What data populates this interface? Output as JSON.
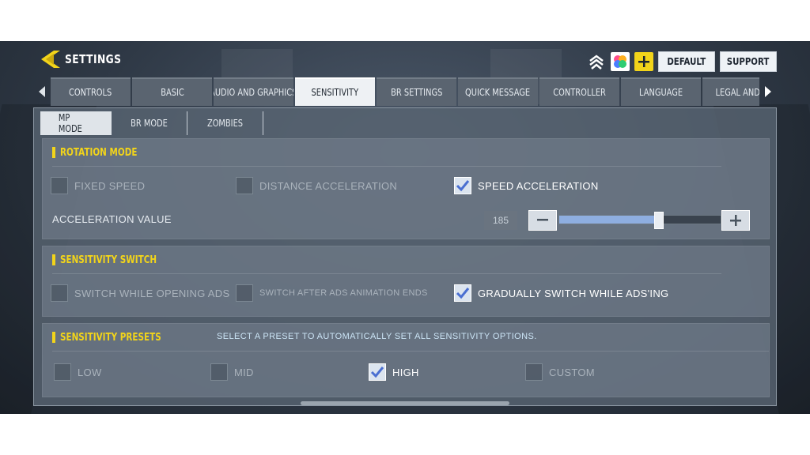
{
  "header": {
    "title": "SETTINGS",
    "icons": [
      "back-chevron-icon",
      "rank-icon",
      "color-blob-icon",
      "plus-icon"
    ],
    "buttons": {
      "default": "DEFAULT",
      "support": "SUPPORT"
    }
  },
  "tabs": [
    {
      "label": "CONTROLS",
      "active": false
    },
    {
      "label": "BASIC",
      "active": false
    },
    {
      "label": "AUDIO AND GRAPHICS",
      "active": false
    },
    {
      "label": "SENSITIVITY",
      "active": true
    },
    {
      "label": "BR SETTINGS",
      "active": false
    },
    {
      "label": "QUICK MESSAGE",
      "active": false
    },
    {
      "label": "CONTROLLER",
      "active": false
    },
    {
      "label": "LANGUAGE",
      "active": false
    },
    {
      "label": "LEGAL AND PI",
      "active": false
    }
  ],
  "subtabs": [
    {
      "label": "MP MODE",
      "active": true
    },
    {
      "label": "BR MODE",
      "active": false
    },
    {
      "label": "ZOMBIES",
      "active": false
    }
  ],
  "rotation_mode": {
    "title": "ROTATION MODE",
    "options": [
      {
        "label": "FIXED SPEED",
        "checked": false
      },
      {
        "label": "DISTANCE ACCELERATION",
        "checked": false
      },
      {
        "label": "SPEED ACCELERATION",
        "checked": true
      }
    ],
    "acceleration": {
      "label": "ACCELERATION VALUE",
      "value": "185",
      "fraction": 0.62
    }
  },
  "sensitivity_switch": {
    "title": "SENSITIVITY SWITCH",
    "options": [
      {
        "label": "SWITCH WHILE OPENING ADS",
        "checked": false
      },
      {
        "label": "SWITCH AFTER ADS ANIMATION ENDS",
        "checked": false
      },
      {
        "label": "GRADUALLY SWITCH WHILE ADS'ING",
        "checked": true
      }
    ]
  },
  "sensitivity_presets": {
    "title": "SENSITIVITY PRESETS",
    "description": "SELECT A PRESET TO AUTOMATICALLY SET ALL SENSITIVITY OPTIONS.",
    "options": [
      {
        "label": "LOW",
        "checked": false
      },
      {
        "label": "MID",
        "checked": false
      },
      {
        "label": "HIGH",
        "checked": true
      },
      {
        "label": "CUSTOM",
        "checked": false
      }
    ]
  },
  "colors": {
    "accent": "#f2d41a",
    "slider_fill": "#8eaee0",
    "active_tab": "#eef1f4"
  }
}
